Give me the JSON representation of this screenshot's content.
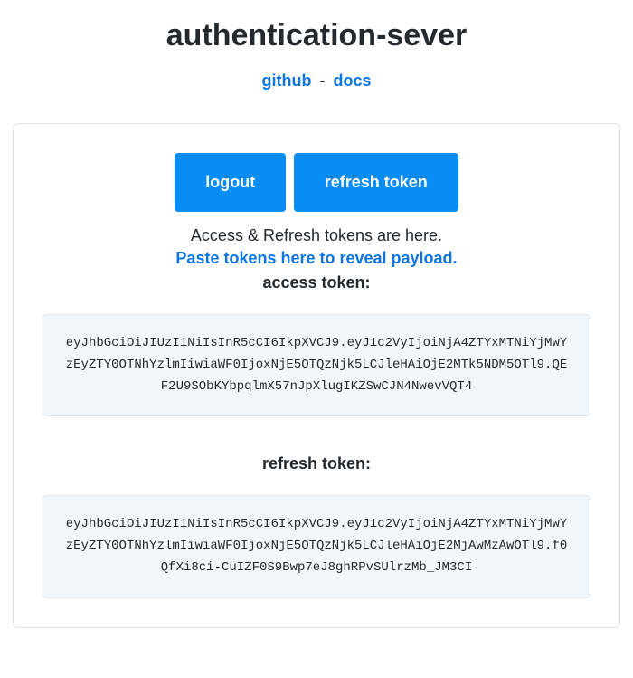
{
  "header": {
    "title": "authentication-sever",
    "links": {
      "github": "github",
      "docs": "docs",
      "separator": "-"
    }
  },
  "panel": {
    "buttons": {
      "logout": "logout",
      "refresh": "refresh token"
    },
    "info_text": "Access & Refresh tokens are here.",
    "paste_link_text": "Paste tokens here to reveal payload.",
    "access_token_label": "access token:",
    "access_token_value": "eyJhbGciOiJIUzI1NiIsInR5cCI6IkpXVCJ9.eyJ1c2VyIjoiNjA4ZTYxMTNiYjMwYzEyZTY0OTNhYzlmIiwiaWF0IjoxNjE5OTQzNjk5LCJleHAiOjE2MTk5NDM5OTl9.QEF2U9SObKYbpqlmX57nJpXlugIKZSwCJN4NwevVQT4",
    "refresh_token_label": "refresh token:",
    "refresh_token_value": "eyJhbGciOiJIUzI1NiIsInR5cCI6IkpXVCJ9.eyJ1c2VyIjoiNjA4ZTYxMTNiYjMwYzEyZTY0OTNhYzlmIiwiaWF0IjoxNjE5OTQzNjk5LCJleHAiOjE2MjAwMzAwOTl9.f0QfXi8ci-CuIZF0S9Bwp7eJ8ghRPvSUlrzMb_JM3CI"
  }
}
